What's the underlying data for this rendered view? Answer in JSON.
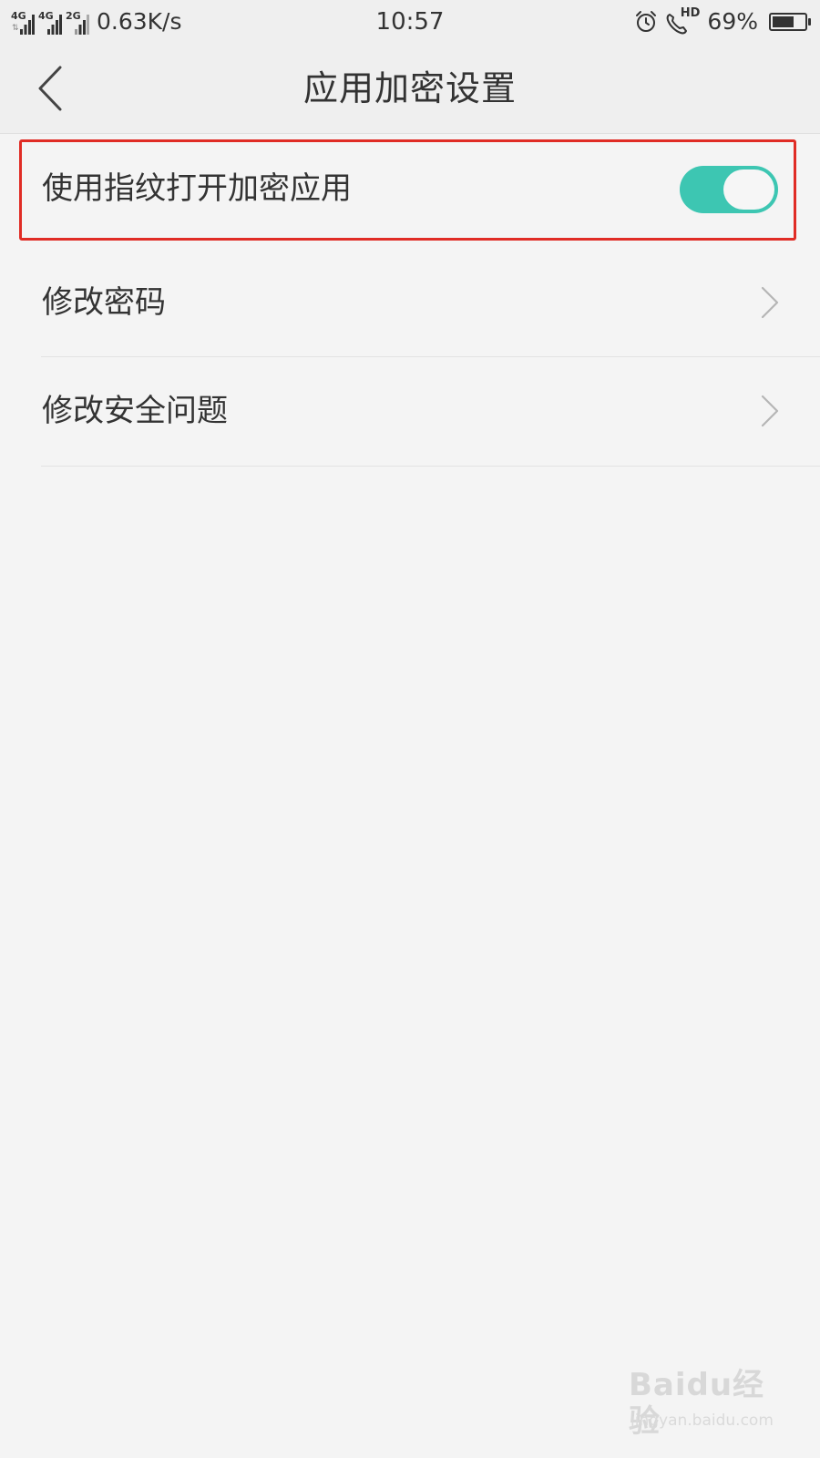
{
  "status_bar": {
    "sim1_network": "4G",
    "sim1_secondary": "4G",
    "sim2_network": "2G",
    "net_speed": "0.63K/s",
    "time": "10:57",
    "hd_label": "HD",
    "battery_percent": "69%",
    "battery_level": 0.69
  },
  "header": {
    "title": "应用加密设置"
  },
  "settings": {
    "fingerprint_label": "使用指纹打开加密应用",
    "fingerprint_enabled": true,
    "change_password_label": "修改密码",
    "change_security_question_label": "修改安全问题"
  },
  "colors": {
    "toggle_on": "#3dc6b2",
    "highlight": "#e02c25",
    "background": "#f4f4f4"
  },
  "watermark": {
    "brand": "Baidu经验",
    "url": "jingyan.baidu.com"
  }
}
